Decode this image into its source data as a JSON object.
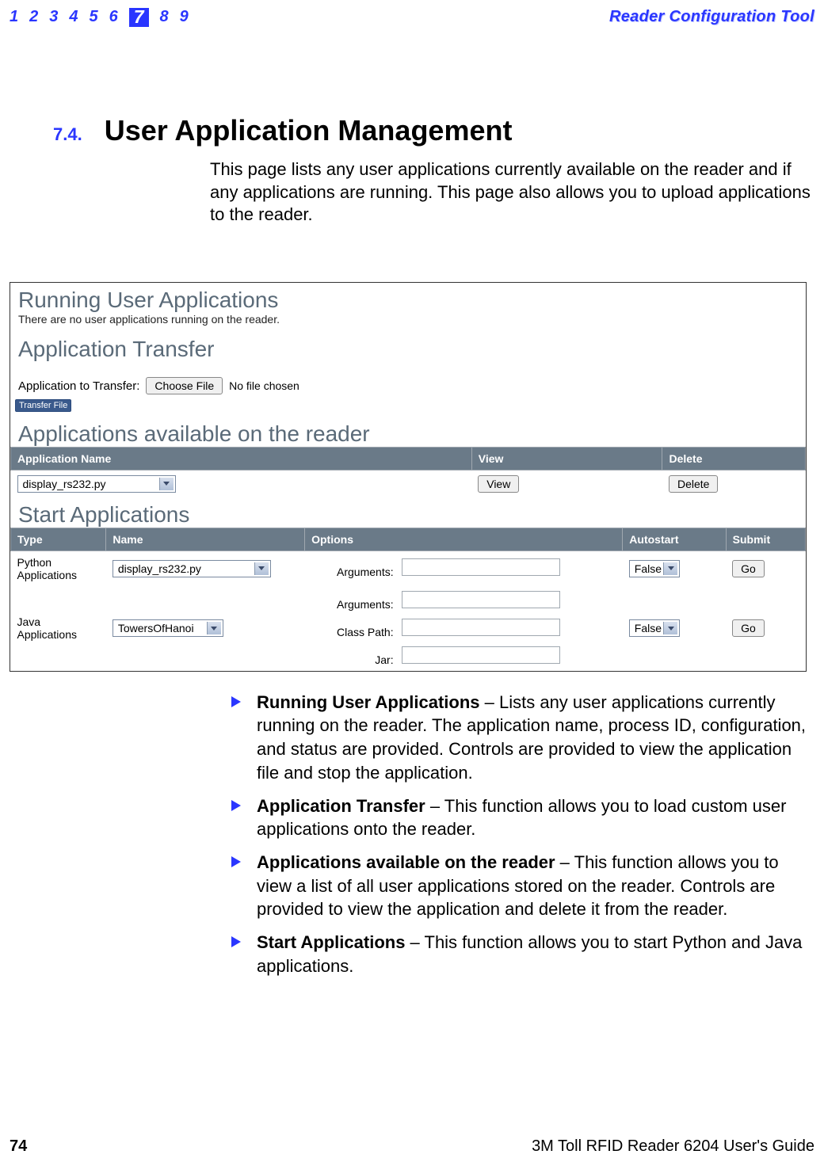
{
  "header": {
    "tabs": [
      "1",
      "2",
      "3",
      "4",
      "5",
      "6",
      "7",
      "8",
      "9"
    ],
    "current_tab": "7",
    "tool_name": "Reader Configuration Tool"
  },
  "section": {
    "number": "7.4.",
    "title": "User Application Management",
    "intro": "This page lists any user applications currently available on the reader and if any applications are running. This page also allows you to upload applications to the reader."
  },
  "screenshot": {
    "running_title": "Running User Applications",
    "running_msg": "There are no user applications running on the reader.",
    "transfer_title": "Application Transfer",
    "transfer_label": "Application to Transfer:",
    "choose_file_btn": "Choose File",
    "no_file": "No file chosen",
    "transfer_btn": "Transfer File",
    "available_title": "Applications available on the reader",
    "avail_cols": {
      "name": "Application Name",
      "view": "View",
      "delete": "Delete"
    },
    "avail_row": {
      "name": "display_rs232.py",
      "view_btn": "View",
      "delete_btn": "Delete"
    },
    "start_title": "Start Applications",
    "start_cols": {
      "type": "Type",
      "name": "Name",
      "options": "Options",
      "autostart": "Autostart",
      "submit": "Submit"
    },
    "python_row": {
      "type": "Python Applications",
      "name": "display_rs232.py",
      "arg_label": "Arguments:",
      "autostart": "False",
      "go": "Go"
    },
    "java_row": {
      "type": "Java Applications",
      "name": "TowersOfHanoi",
      "arg_label": "Arguments:",
      "classpath_label": "Class Path:",
      "jar_label": "Jar:",
      "autostart": "False",
      "go": "Go"
    }
  },
  "bullets": [
    {
      "title": "Running User Applications",
      "body": " – Lists any user applications currently running on the reader. The application name, process ID, configuration, and status are provided. Controls are provided to view the application file and stop the application."
    },
    {
      "title": "Application Transfer",
      "body": " – This function allows you to load custom user applications onto the reader."
    },
    {
      "title": "Applications available on the reader",
      "body": " – This function allows you to view a list of all user applications stored on the reader. Controls are provided to view the application and delete it from the reader."
    },
    {
      "title": "Start Applications",
      "body": " – This function allows you to start Python and Java applications."
    }
  ],
  "footer": {
    "page_num": "74",
    "guide": "3M Toll RFID Reader 6204 User's Guide"
  }
}
